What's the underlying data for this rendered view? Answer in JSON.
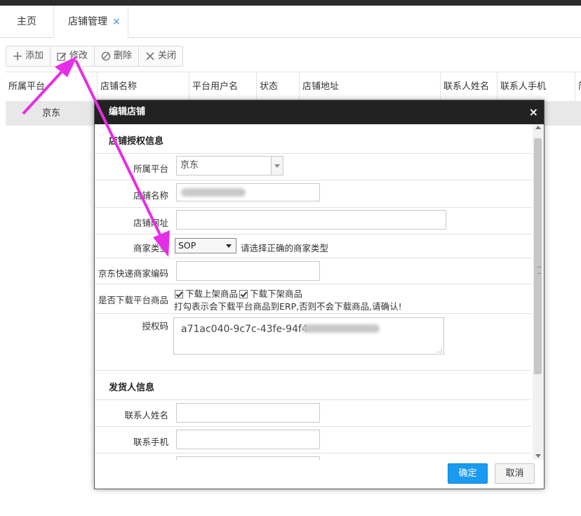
{
  "tabs": {
    "home": "主页",
    "active": "店铺管理",
    "close_glyph": "×"
  },
  "toolbar": {
    "add": "添加",
    "edit": "修改",
    "delete": "删除",
    "close": "关闭"
  },
  "grid": {
    "columns": [
      "所属平台",
      "店铺名称",
      "平台用户名",
      "状态",
      "店铺地址",
      "联系人姓名",
      "联系人手机",
      "简"
    ],
    "row_platform": "京东"
  },
  "dialog": {
    "title": "编辑店铺",
    "close_glyph": "×",
    "section_auth": "店铺授权信息",
    "platform_label": "所属平台",
    "platform_value": "京东",
    "shop_name_label": "店铺名称",
    "shop_url_label": "店铺网址",
    "merchant_type_label": "商家类型",
    "merchant_type_value": "SOP",
    "merchant_type_hint": "请选择正确的商家类型",
    "express_code_label": "京东快递商家编码",
    "download_label": "是否下载平台商品",
    "download_onshelf": "下载上架商品",
    "download_offshelf": "下载下架商品",
    "download_hint": "打勾表示会下载平台商品到ERP,否则不会下载商品,请确认!",
    "auth_code_label": "授权码",
    "auth_code_value": "a71ac040-9c7c-43fe-94f4",
    "section_sender": "发货人信息",
    "contact_name_label": "联系人姓名",
    "contact_phone_label": "联系手机",
    "ok": "确定",
    "cancel": "取消"
  },
  "colors": {
    "accent": "#1a9bf0",
    "annotation_arrow": "#e62ee6"
  }
}
